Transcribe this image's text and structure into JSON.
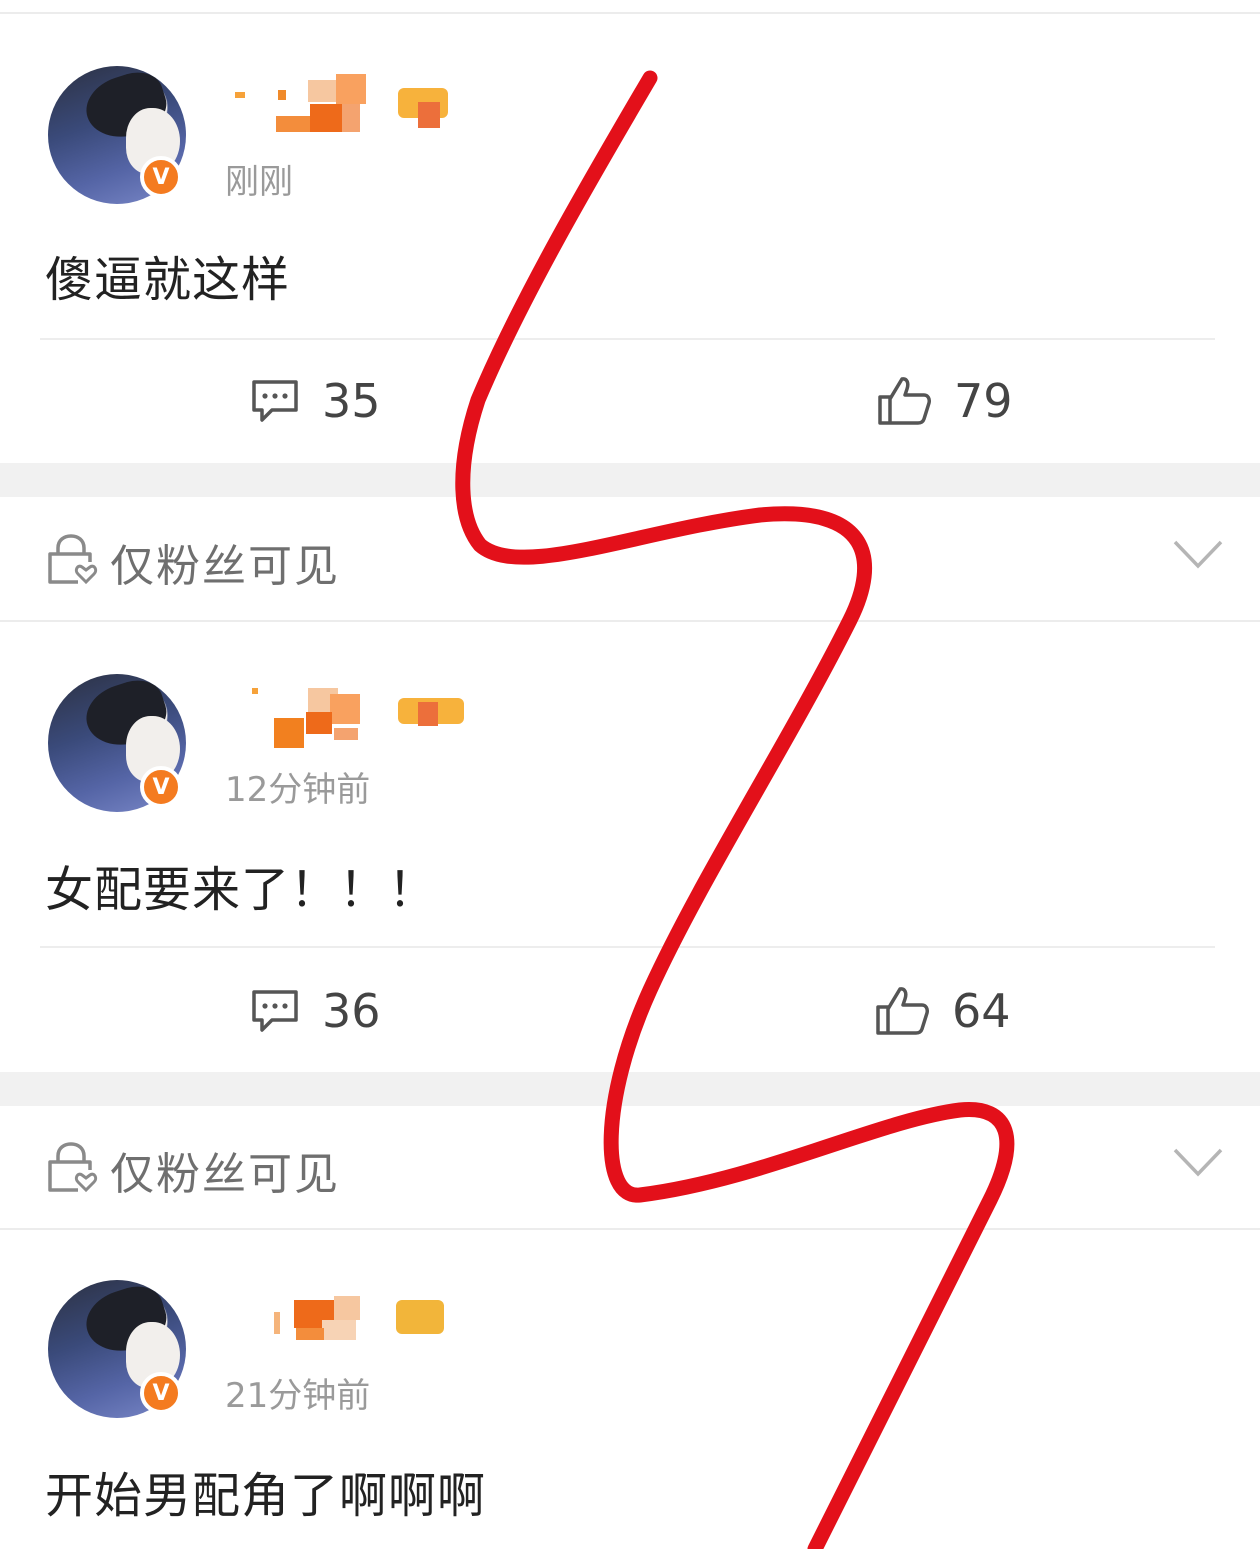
{
  "posts": [
    {
      "timestamp": "刚刚",
      "content": "傻逼就这样",
      "comments": "35",
      "likes": "79"
    },
    {
      "timestamp": "12分钟前",
      "content": "女配要来了！！！",
      "comments": "36",
      "likes": "64"
    },
    {
      "timestamp": "21分钟前",
      "content": "开始男配角了啊啊啊"
    }
  ],
  "visibility_label": "仅粉丝可见",
  "icons": {
    "comment": "comment-icon",
    "like": "thumbs-up-icon",
    "lock": "lock-heart-icon",
    "expand": "chevron-down-icon",
    "verified": "verified-v-badge"
  },
  "colors": {
    "verified_badge": "#f47b20",
    "annotation_line": "#e3101a",
    "timestamp": "#9a9a9a",
    "separator": "#f1f1f1"
  }
}
